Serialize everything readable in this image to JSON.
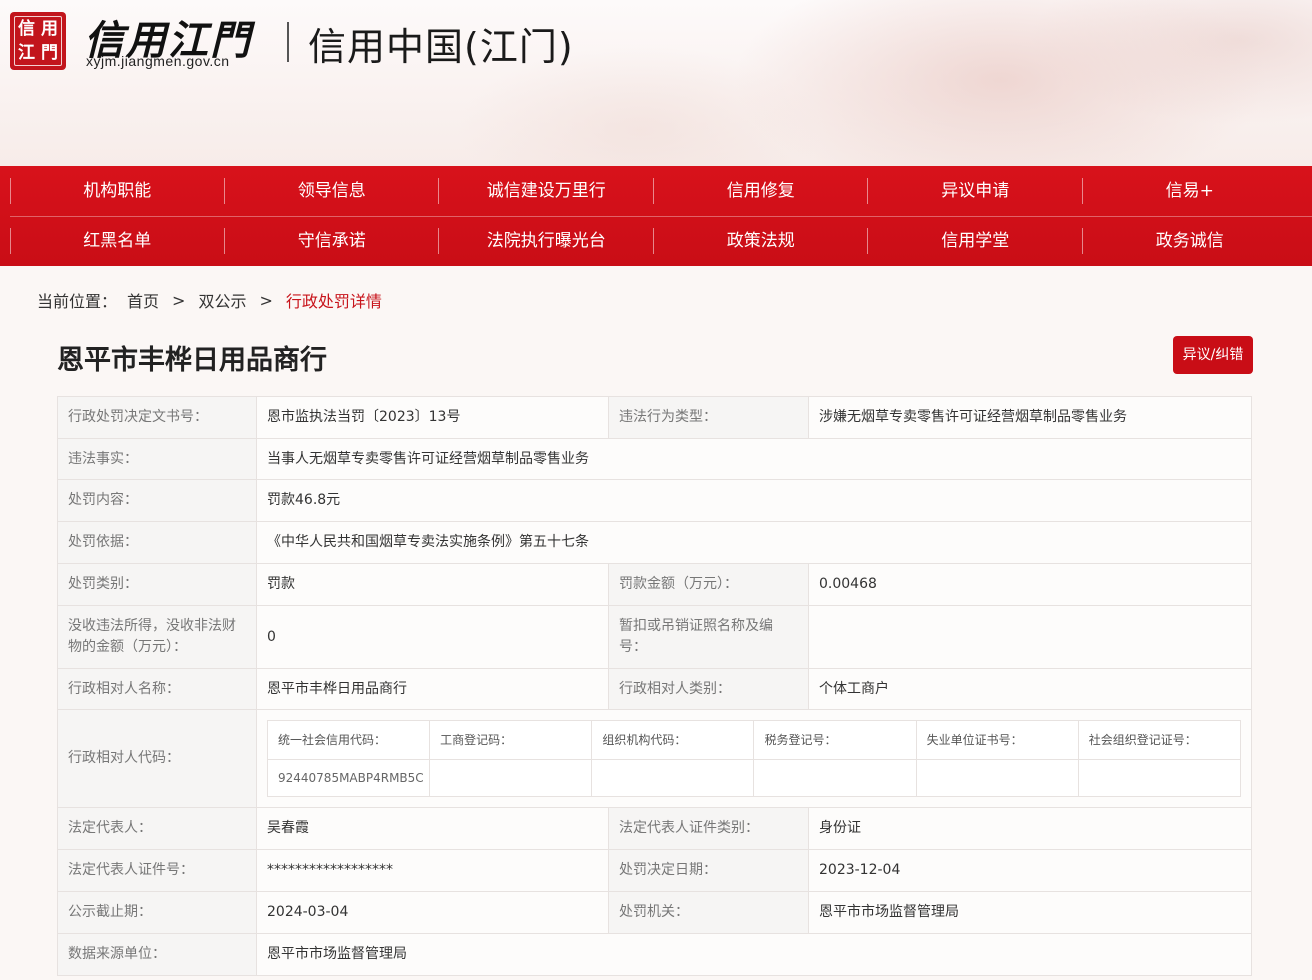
{
  "logo": {
    "badge_chars": [
      "信",
      "用",
      "江",
      "門"
    ],
    "calligraphy": "信用江門",
    "url": "xyjm.jiangmen.gov.cn"
  },
  "site_title": "信用中国(江门)",
  "nav": {
    "row1": [
      "机构职能",
      "领导信息",
      "诚信建设万里行",
      "信用修复",
      "异议申请",
      "信易+"
    ],
    "row2": [
      "红黑名单",
      "守信承诺",
      "法院执行曝光台",
      "政策法规",
      "信用学堂",
      "政务诚信"
    ]
  },
  "breadcrumb": {
    "label": "当前位置：",
    "items": [
      "首页",
      "双公示",
      "行政处罚详情"
    ],
    "separator": ">"
  },
  "title": "恩平市丰桦日用品商行",
  "objection_button": "异议/纠错",
  "details": {
    "doc_number_label": "行政处罚决定文书号：",
    "doc_number": "恩市监执法当罚〔2023〕13号",
    "violation_type_label": "违法行为类型：",
    "violation_type": "涉嫌无烟草专卖零售许可证经营烟草制品零售业务",
    "facts_label": "违法事实：",
    "facts": "当事人无烟草专卖零售许可证经营烟草制品零售业务",
    "content_label": "处罚内容：",
    "content": "罚款46.8元",
    "basis_label": "处罚依据：",
    "basis": "《中华人民共和国烟草专卖法实施条例》第五十七条",
    "category_label": "处罚类别：",
    "category": "罚款",
    "amount_label": "罚款金额（万元）：",
    "amount": "0.00468",
    "confiscated_label": "没收违法所得，没收非法财物的金额（万元）：",
    "confiscated": "0",
    "license_label": "暂扣或吊销证照名称及编号：",
    "license": "",
    "party_name_label": "行政相对人名称：",
    "party_name": "恩平市丰桦日用品商行",
    "party_type_label": "行政相对人类别：",
    "party_type": "个体工商户",
    "party_code_label": "行政相对人代码：",
    "codes": {
      "headers": [
        "统一社会信用代码：",
        "工商登记码：",
        "组织机构代码：",
        "税务登记号：",
        "失业单位证书号：",
        "社会组织登记证号："
      ],
      "values": [
        "92440785MABP4RMB5C",
        "",
        "",
        "",
        "",
        ""
      ]
    },
    "legal_rep_label": "法定代表人：",
    "legal_rep": "吴春霞",
    "legal_id_type_label": "法定代表人证件类别：",
    "legal_id_type": "身份证",
    "legal_id_label": "法定代表人证件号：",
    "legal_id": "******************",
    "decision_date_label": "处罚决定日期：",
    "decision_date": "2023-12-04",
    "deadline_label": "公示截止期：",
    "deadline": "2024-03-04",
    "authority_label": "处罚机关：",
    "authority": "恩平市市场监督管理局",
    "source_label": "数据来源单位：",
    "source": "恩平市市场监督管理局"
  }
}
